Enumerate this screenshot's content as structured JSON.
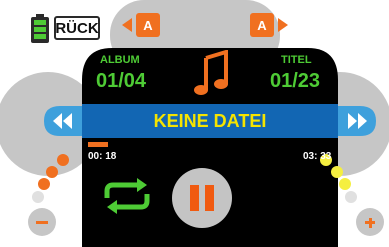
{
  "header": {
    "back_label": "RÜCK"
  },
  "album": {
    "label": "ALBUM",
    "value": "01/04"
  },
  "title": {
    "label": "TITEL",
    "value": "01/23"
  },
  "track": {
    "name": "KEINE DATEI",
    "elapsed": "00: 18",
    "total": "03: 33",
    "progress_fraction": 0.08
  },
  "album_nav": {
    "prev_label": "A",
    "next_label": "A"
  },
  "volume": {
    "minus_label": "−",
    "plus_label": "+"
  },
  "icons": {
    "battery": "battery-icon",
    "music": "music-note-icon",
    "repeat": "repeat-icon",
    "pause": "pause-icon",
    "prev": "skip-back-icon",
    "next": "skip-forward-icon"
  },
  "colors": {
    "accent_orange": "#f07020",
    "pause_orange": "#f05a10",
    "blue": "#3ea0dc",
    "green": "#4ecb35",
    "yellow": "#f5e400",
    "bar_blue": "#1266b3"
  }
}
